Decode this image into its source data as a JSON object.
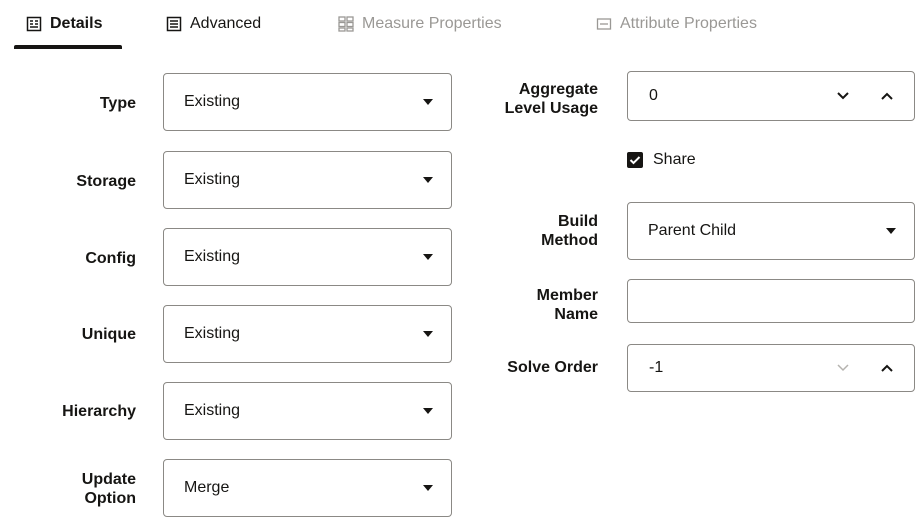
{
  "tabs": [
    {
      "label": "Details",
      "icon": "details-icon"
    },
    {
      "label": "Advanced",
      "icon": "advanced-icon"
    },
    {
      "label": "Measure Properties",
      "icon": "measure-grid-icon"
    },
    {
      "label": "Attribute Properties",
      "icon": "attribute-icon"
    }
  ],
  "left_fields": [
    {
      "label": "Type",
      "value": "Existing"
    },
    {
      "label": "Storage",
      "value": "Existing"
    },
    {
      "label": "Config",
      "value": "Existing"
    },
    {
      "label": "Unique",
      "value": "Existing"
    },
    {
      "label": "Hierarchy",
      "value": "Existing"
    },
    {
      "label_line1": "Update",
      "label_line2": "Option",
      "value": "Merge"
    }
  ],
  "right": {
    "aggregate_label_line1": "Aggregate",
    "aggregate_label_line2": "Level Usage",
    "aggregate_value": "0",
    "share_label": "Share",
    "share_checked": true,
    "build_label_line1": "Build",
    "build_label_line2": "Method",
    "build_value": "Parent Child",
    "member_label_line1": "Member",
    "member_label_line2": "Name",
    "member_value": "",
    "solve_label": "Solve Order",
    "solve_value": "-1"
  }
}
